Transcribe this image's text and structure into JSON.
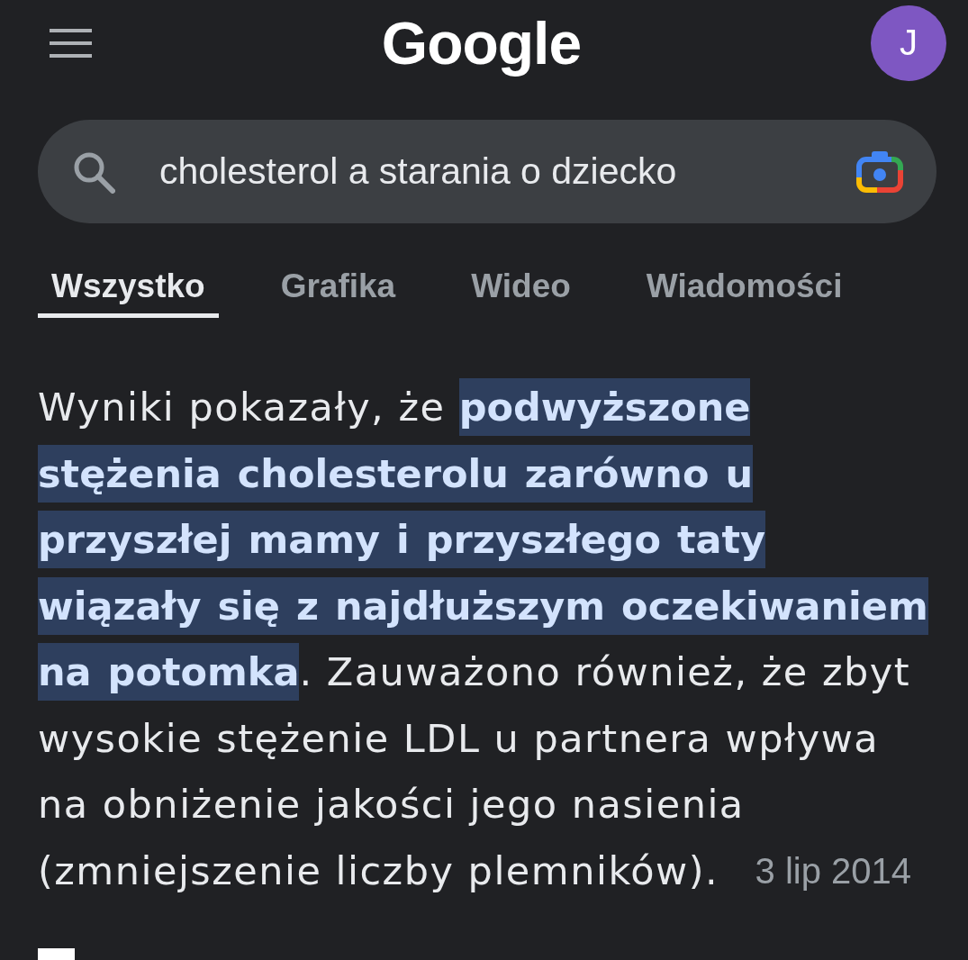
{
  "header": {
    "logo": "Google",
    "avatar_initial": "J"
  },
  "search": {
    "value": "cholesterol a starania o dziecko"
  },
  "tabs": [
    {
      "label": "Wszystko",
      "selected": true
    },
    {
      "label": "Grafika",
      "selected": false
    },
    {
      "label": "Wideo",
      "selected": false
    },
    {
      "label": "Wiadomości",
      "selected": false
    }
  ],
  "featured_snippet": {
    "text": "Wyniki pokazały, że **podwyższone stężenia cholesterolu zarówno u przyszłej mamy i przyszłego taty wiązały się z najdłuższym oczekiwaniem na potomka**. Zauważono również, że zbyt wysokie stężenie LDL u partnera wpływa na obniżenie jakości jego nasienia (zmniejszenie liczby plemników).",
    "date": "3 lip 2014"
  }
}
